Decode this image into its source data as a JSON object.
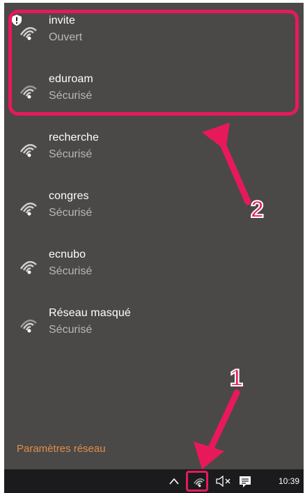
{
  "networks": [
    {
      "name": "invite",
      "status": "Ouvert"
    },
    {
      "name": "eduroam",
      "status": "Sécurisé"
    },
    {
      "name": "recherche",
      "status": "Sécurisé"
    },
    {
      "name": "congres",
      "status": "Sécurisé"
    },
    {
      "name": "ecnubo",
      "status": "Sécurisé"
    },
    {
      "name": "Réseau masqué",
      "status": "Sécurisé"
    }
  ],
  "settings_link": "Paramètres réseau",
  "taskbar": {
    "clock": "10:39",
    "icons": [
      "chevron-up-icon",
      "wifi-icon",
      "volume-muted-icon",
      "notification-icon"
    ]
  },
  "annotations": {
    "callout_1": "1",
    "callout_2": "2"
  },
  "colors": {
    "accent": "#e28d48",
    "highlight": "#e8195b",
    "panel_bg": "#4a4948",
    "taskbar_bg": "#1b1b1d"
  }
}
